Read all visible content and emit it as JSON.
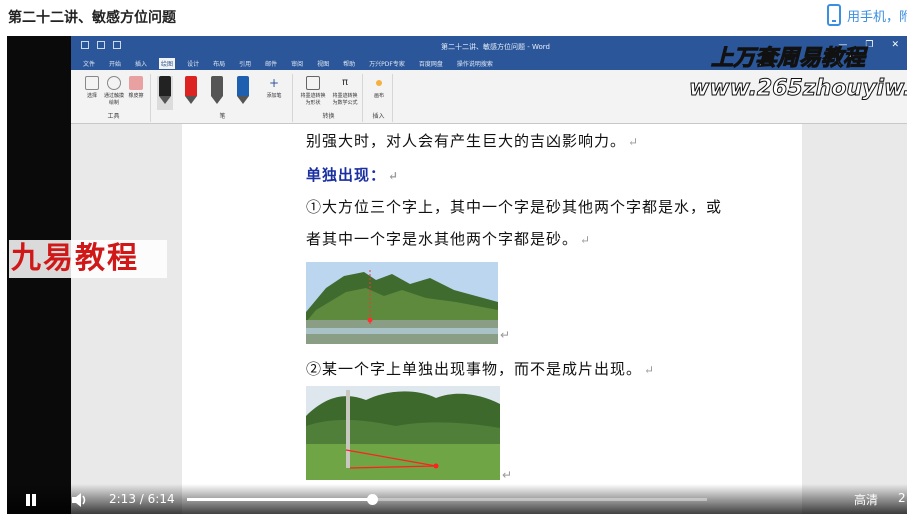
{
  "page": {
    "title": "第二十二讲、敏感方位问题",
    "phone_link": "用手机，附"
  },
  "word": {
    "doc_title": "第二十二讲、敏感方位问题 - Word",
    "qat": [
      "save",
      "undo",
      "redo"
    ],
    "tabs": [
      "文件",
      "开始",
      "插入",
      "绘图",
      "设计",
      "布局",
      "引用",
      "邮件",
      "审阅",
      "视图",
      "帮助",
      "万兴PDF专家",
      "百度网盘",
      "操作说明搜索"
    ],
    "active_tab": "绘图",
    "ribbon": {
      "group_tools": "工具",
      "group_pens": "笔",
      "group_convert": "转换",
      "group_insert": "插入",
      "btn_select": "选择",
      "btn_lasso": "通过触摸绘制",
      "btn_eraser": "橡皮擦",
      "btn_add_pen": "添加笔",
      "btn_ink_to_shape": "将墨迹转换为形状",
      "btn_ink_to_math": "将墨迹转换为数学公式",
      "btn_canvas": "画布",
      "pen_colors": [
        "#222222",
        "#d22222",
        "#555555",
        "#1e5fb0"
      ]
    }
  },
  "document": {
    "line1": "别强大时，对人会有产生巨大的吉凶影响力。",
    "heading": "单独出现：",
    "line2": "①大方位三个字上，其中一个字是砂其他两个字都是水，或",
    "line3": "者其中一个字是水其他两个字都是砂。",
    "line4": "②某一个字上单独出现事物，而不是成片出现。",
    "return_mark": "↵"
  },
  "watermarks": {
    "cn": "上万套周易教程",
    "url": "www.265zhouyiw.com",
    "brand": "九易教程"
  },
  "player": {
    "current_time": "2:13",
    "separator": "/",
    "duration": "6:14",
    "progress": 0.356,
    "quality": "高清",
    "speed_label": "2"
  }
}
